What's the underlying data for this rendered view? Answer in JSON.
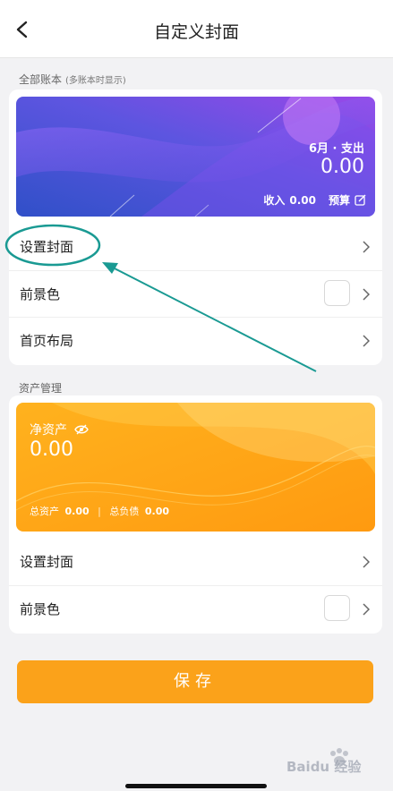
{
  "header": {
    "title": "自定义封面"
  },
  "section1": {
    "label": "全部账本",
    "sublabel": "(多账本时显示)",
    "cover": {
      "period": "6月 · 支出",
      "amount": "0.00",
      "income_label": "收入",
      "income_value": "0.00",
      "budget_label": "预算"
    },
    "rows": [
      {
        "label": "设置封面"
      },
      {
        "label": "前景色"
      },
      {
        "label": "首页布局"
      }
    ]
  },
  "section2": {
    "label": "资产管理",
    "cover": {
      "title": "净资产",
      "amount": "0.00",
      "total_assets_label": "总资产",
      "total_assets_value": "0.00",
      "divider": "|",
      "total_liabilities_label": "总负债",
      "total_liabilities_value": "0.00"
    },
    "rows": [
      {
        "label": "设置封面"
      },
      {
        "label": "前景色"
      }
    ]
  },
  "save_label": "保存",
  "watermark": {
    "text": "Baidu 经验"
  },
  "colors": {
    "accent": "#fba21a",
    "annotation": "#1a9a93",
    "cover_blue_start": "#3a4bc5",
    "cover_blue_end": "#8a45e6"
  }
}
